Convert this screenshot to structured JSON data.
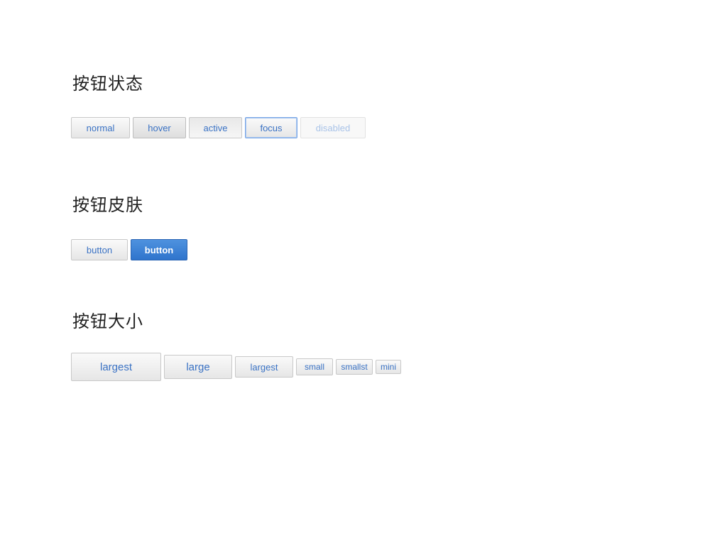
{
  "sections": [
    {
      "title": "按钮状态",
      "buttons": [
        "normal",
        "hover",
        "active",
        "focus",
        "disabled"
      ]
    },
    {
      "title": "按钮皮肤",
      "buttons": [
        "button",
        "button"
      ]
    },
    {
      "title": "按钮大小",
      "buttons": [
        "largest",
        "large",
        "largest",
        "small",
        "smallst",
        "mini"
      ]
    }
  ],
  "colors": {
    "button_text": "#3a72c4",
    "primary_bg": "#3a82d6",
    "disabled_text": "#a9c3e8"
  }
}
